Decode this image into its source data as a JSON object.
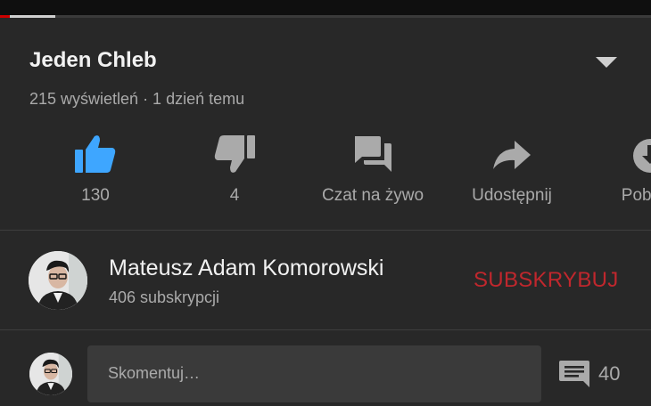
{
  "player": {
    "progress_played": 0.015,
    "progress_buffered": 0.085
  },
  "video": {
    "title": "Jeden Chleb",
    "meta": "215 wyświetleń · 1 dzień temu"
  },
  "actions": [
    {
      "name": "like",
      "label": "130",
      "icon": "thumb-up-icon",
      "color": "#3ea6ff"
    },
    {
      "name": "dislike",
      "label": "4",
      "icon": "thumb-down-icon",
      "color": "#aaaaaa"
    },
    {
      "name": "live-chat",
      "label": "Czat na żywo",
      "icon": "chat-icon",
      "color": "#aaaaaa"
    },
    {
      "name": "share",
      "label": "Udostępnij",
      "icon": "share-icon",
      "color": "#aaaaaa"
    },
    {
      "name": "download",
      "label": "Pobierz",
      "icon": "download-icon",
      "color": "#aaaaaa"
    }
  ],
  "channel": {
    "name": "Mateusz Adam Komorowski",
    "subscribers": "406 subskrypcji",
    "subscribe_label": "SUBSKRYBUJ",
    "subscribe_color": "#c0272d"
  },
  "comments": {
    "placeholder": "Skomentuj…",
    "count": "40"
  }
}
